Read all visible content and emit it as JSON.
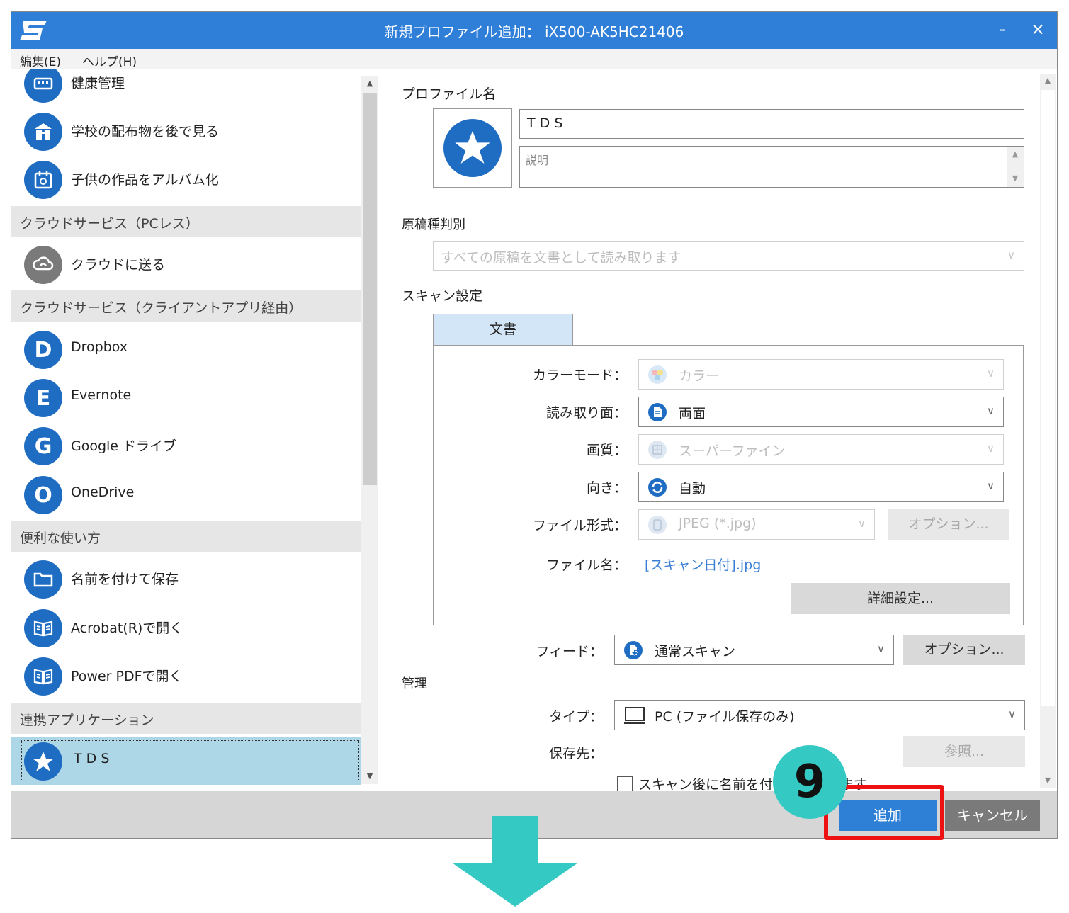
{
  "window": {
    "title": "新規プロファイル追加： iX500-AK5HC21406",
    "minimize_label": "-",
    "close_label": "×"
  },
  "menu": {
    "edit": "編集(E)",
    "help": "ヘルプ(H)"
  },
  "sidebar": {
    "items": [
      {
        "kind": "item",
        "label": "健康管理",
        "icon": "keyboard-icon"
      },
      {
        "kind": "item",
        "label": "学校の配布物を後で見る",
        "icon": "school-icon"
      },
      {
        "kind": "item",
        "label": "子供の作品をアルバム化",
        "icon": "album-icon"
      },
      {
        "kind": "header",
        "label": "クラウドサービス（PCレス）"
      },
      {
        "kind": "item",
        "label": "クラウドに送る",
        "icon": "cloud-icon"
      },
      {
        "kind": "header",
        "label": "クラウドサービス（クライアントアプリ経由）"
      },
      {
        "kind": "item",
        "label": "Dropbox",
        "icon": "dropbox-icon",
        "glyph": "D"
      },
      {
        "kind": "item",
        "label": "Evernote",
        "icon": "evernote-icon",
        "glyph": "E"
      },
      {
        "kind": "item",
        "label": "Google ドライブ",
        "icon": "google-drive-icon",
        "glyph": "G"
      },
      {
        "kind": "item",
        "label": "OneDrive",
        "icon": "onedrive-icon",
        "glyph": "O"
      },
      {
        "kind": "header",
        "label": "便利な使い方"
      },
      {
        "kind": "item",
        "label": "名前を付けて保存",
        "icon": "folder-icon"
      },
      {
        "kind": "item",
        "label": "Acrobat(R)で開く",
        "icon": "book-icon"
      },
      {
        "kind": "item",
        "label": "Power PDFで開く",
        "icon": "book-icon"
      },
      {
        "kind": "header",
        "label": "連携アプリケーション"
      },
      {
        "kind": "item",
        "label": "T D S",
        "icon": "star-icon",
        "selected": true
      }
    ]
  },
  "profile": {
    "section_label": "プロファイル名",
    "name_value": "T D S",
    "description_placeholder": "説明"
  },
  "doc_type": {
    "section_label": "原稿種判別",
    "value": "すべての原稿を文書として読み取ります"
  },
  "scan_settings": {
    "section_label": "スキャン設定",
    "tab_label": "文書",
    "color_mode": {
      "label": "カラーモード：",
      "value": "カラー"
    },
    "scan_side": {
      "label": "読み取り面：",
      "value": "両面"
    },
    "quality": {
      "label": "画質：",
      "value": "スーパーファイン"
    },
    "orientation": {
      "label": "向き：",
      "value": "自動"
    },
    "file_format": {
      "label": "ファイル形式：",
      "value": "JPEG (*.jpg)",
      "option_button": "オプション..."
    },
    "file_name": {
      "label": "ファイル名：",
      "value": "[スキャン日付].jpg"
    },
    "detail_button": "詳細設定..."
  },
  "feed": {
    "label": "フィード：",
    "value": "通常スキャン",
    "option_button": "オプション..."
  },
  "management": {
    "section_label": "管理",
    "type": {
      "label": "タイプ：",
      "value": "PC (ファイル保存のみ)"
    },
    "destination": {
      "label": "保存先：",
      "browse_button": "参照..."
    },
    "rename_checkbox_label": "スキャン後に名前を付けて保存します"
  },
  "footer": {
    "add_button": "追加",
    "cancel_button": "キャンセル"
  },
  "annotation": {
    "step_number": "9"
  },
  "colors": {
    "titlebar": "#2f7fd9",
    "selected_item": "#add7e6",
    "add_button": "#2d80d6",
    "highlight_box": "#ee1111",
    "step_badge": "#35c9c4",
    "arrow": "#35c9c4",
    "icon_blue": "#1f6dc2",
    "file_name_link": "#3a7fd5"
  }
}
